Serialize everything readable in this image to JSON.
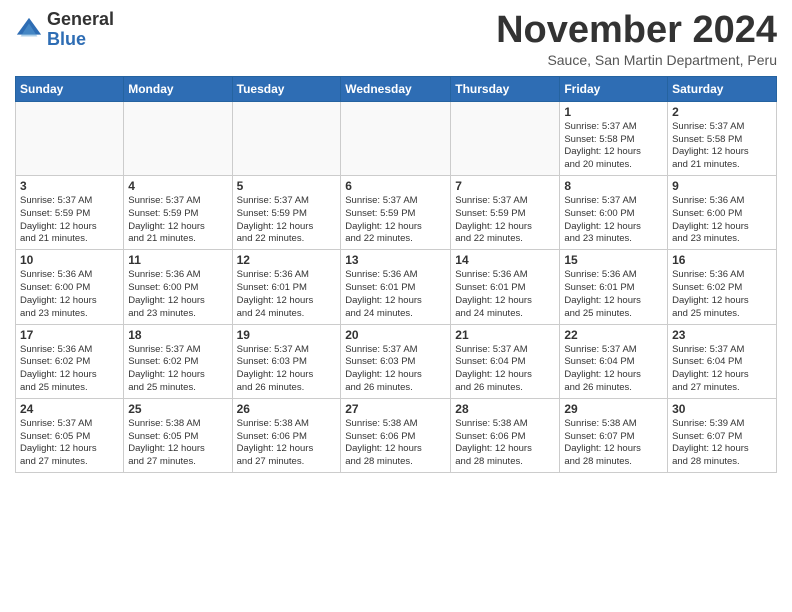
{
  "logo": {
    "general": "General",
    "blue": "Blue"
  },
  "title": "November 2024",
  "subtitle": "Sauce, San Martin Department, Peru",
  "days_of_week": [
    "Sunday",
    "Monday",
    "Tuesday",
    "Wednesday",
    "Thursday",
    "Friday",
    "Saturday"
  ],
  "weeks": [
    [
      {
        "day": "",
        "info": ""
      },
      {
        "day": "",
        "info": ""
      },
      {
        "day": "",
        "info": ""
      },
      {
        "day": "",
        "info": ""
      },
      {
        "day": "",
        "info": ""
      },
      {
        "day": "1",
        "info": "Sunrise: 5:37 AM\nSunset: 5:58 PM\nDaylight: 12 hours\nand 20 minutes."
      },
      {
        "day": "2",
        "info": "Sunrise: 5:37 AM\nSunset: 5:58 PM\nDaylight: 12 hours\nand 21 minutes."
      }
    ],
    [
      {
        "day": "3",
        "info": "Sunrise: 5:37 AM\nSunset: 5:59 PM\nDaylight: 12 hours\nand 21 minutes."
      },
      {
        "day": "4",
        "info": "Sunrise: 5:37 AM\nSunset: 5:59 PM\nDaylight: 12 hours\nand 21 minutes."
      },
      {
        "day": "5",
        "info": "Sunrise: 5:37 AM\nSunset: 5:59 PM\nDaylight: 12 hours\nand 22 minutes."
      },
      {
        "day": "6",
        "info": "Sunrise: 5:37 AM\nSunset: 5:59 PM\nDaylight: 12 hours\nand 22 minutes."
      },
      {
        "day": "7",
        "info": "Sunrise: 5:37 AM\nSunset: 5:59 PM\nDaylight: 12 hours\nand 22 minutes."
      },
      {
        "day": "8",
        "info": "Sunrise: 5:37 AM\nSunset: 6:00 PM\nDaylight: 12 hours\nand 23 minutes."
      },
      {
        "day": "9",
        "info": "Sunrise: 5:36 AM\nSunset: 6:00 PM\nDaylight: 12 hours\nand 23 minutes."
      }
    ],
    [
      {
        "day": "10",
        "info": "Sunrise: 5:36 AM\nSunset: 6:00 PM\nDaylight: 12 hours\nand 23 minutes."
      },
      {
        "day": "11",
        "info": "Sunrise: 5:36 AM\nSunset: 6:00 PM\nDaylight: 12 hours\nand 23 minutes."
      },
      {
        "day": "12",
        "info": "Sunrise: 5:36 AM\nSunset: 6:01 PM\nDaylight: 12 hours\nand 24 minutes."
      },
      {
        "day": "13",
        "info": "Sunrise: 5:36 AM\nSunset: 6:01 PM\nDaylight: 12 hours\nand 24 minutes."
      },
      {
        "day": "14",
        "info": "Sunrise: 5:36 AM\nSunset: 6:01 PM\nDaylight: 12 hours\nand 24 minutes."
      },
      {
        "day": "15",
        "info": "Sunrise: 5:36 AM\nSunset: 6:01 PM\nDaylight: 12 hours\nand 25 minutes."
      },
      {
        "day": "16",
        "info": "Sunrise: 5:36 AM\nSunset: 6:02 PM\nDaylight: 12 hours\nand 25 minutes."
      }
    ],
    [
      {
        "day": "17",
        "info": "Sunrise: 5:36 AM\nSunset: 6:02 PM\nDaylight: 12 hours\nand 25 minutes."
      },
      {
        "day": "18",
        "info": "Sunrise: 5:37 AM\nSunset: 6:02 PM\nDaylight: 12 hours\nand 25 minutes."
      },
      {
        "day": "19",
        "info": "Sunrise: 5:37 AM\nSunset: 6:03 PM\nDaylight: 12 hours\nand 26 minutes."
      },
      {
        "day": "20",
        "info": "Sunrise: 5:37 AM\nSunset: 6:03 PM\nDaylight: 12 hours\nand 26 minutes."
      },
      {
        "day": "21",
        "info": "Sunrise: 5:37 AM\nSunset: 6:04 PM\nDaylight: 12 hours\nand 26 minutes."
      },
      {
        "day": "22",
        "info": "Sunrise: 5:37 AM\nSunset: 6:04 PM\nDaylight: 12 hours\nand 26 minutes."
      },
      {
        "day": "23",
        "info": "Sunrise: 5:37 AM\nSunset: 6:04 PM\nDaylight: 12 hours\nand 27 minutes."
      }
    ],
    [
      {
        "day": "24",
        "info": "Sunrise: 5:37 AM\nSunset: 6:05 PM\nDaylight: 12 hours\nand 27 minutes."
      },
      {
        "day": "25",
        "info": "Sunrise: 5:38 AM\nSunset: 6:05 PM\nDaylight: 12 hours\nand 27 minutes."
      },
      {
        "day": "26",
        "info": "Sunrise: 5:38 AM\nSunset: 6:06 PM\nDaylight: 12 hours\nand 27 minutes."
      },
      {
        "day": "27",
        "info": "Sunrise: 5:38 AM\nSunset: 6:06 PM\nDaylight: 12 hours\nand 28 minutes."
      },
      {
        "day": "28",
        "info": "Sunrise: 5:38 AM\nSunset: 6:06 PM\nDaylight: 12 hours\nand 28 minutes."
      },
      {
        "day": "29",
        "info": "Sunrise: 5:38 AM\nSunset: 6:07 PM\nDaylight: 12 hours\nand 28 minutes."
      },
      {
        "day": "30",
        "info": "Sunrise: 5:39 AM\nSunset: 6:07 PM\nDaylight: 12 hours\nand 28 minutes."
      }
    ]
  ]
}
